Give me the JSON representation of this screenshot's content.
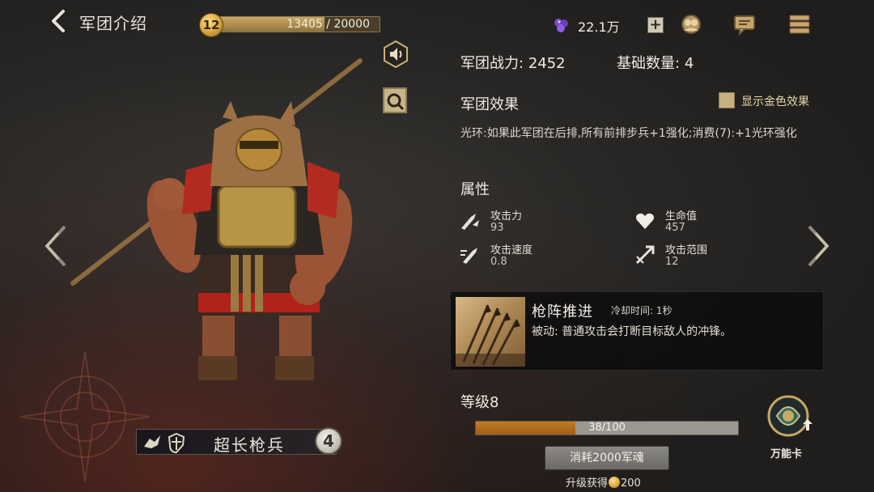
{
  "header": {
    "title": "军团介绍",
    "level": "12",
    "xp_current": "13405",
    "xp_separator": "/",
    "xp_max": "20000",
    "xp_fraction": 0.67,
    "gems": "22.1万",
    "gem_plus": "+"
  },
  "icons": {
    "back": "back-arrow-icon",
    "gem": "purple-gem-icon",
    "alliance": "alliance-icon",
    "chat": "chat-icon",
    "menu": "menu-icon",
    "sound": "speaker-icon",
    "inspect": "magnifier-icon",
    "prev": "left-arrow-icon",
    "next": "right-arrow-icon"
  },
  "unit": {
    "name": "超长枪兵",
    "tier": "4"
  },
  "info": {
    "power_label": "军团战力:",
    "power_value": "2452",
    "base_label": "基础数量:",
    "base_value": "4",
    "effect_title": "军团效果",
    "gold_toggle_label": "显示金色效果",
    "effect_desc": "光环:如果此军团在后排,所有前排步兵+1强化;消费(7):+1光环强化",
    "attr_title": "属性",
    "stats": [
      {
        "name": "攻击力",
        "value": "93",
        "icon": "attack-icon"
      },
      {
        "name": "生命值",
        "value": "457",
        "icon": "heart-icon"
      },
      {
        "name": "攻击速度",
        "value": "0.8",
        "icon": "attack-speed-icon"
      },
      {
        "name": "攻击范围",
        "value": "12",
        "icon": "attack-range-icon"
      }
    ]
  },
  "skill": {
    "name": "枪阵推进",
    "cooldown": "冷却时间: 1秒",
    "desc": "被动: 普通攻击会打断目标敌人的冲锋。"
  },
  "level": {
    "title": "等级8",
    "progress_text": "38/100",
    "progress_fraction": 0.38,
    "consume_label": "消耗2000军魂",
    "reward_prefix": "升级获得",
    "reward_value": "200"
  },
  "wild_card": {
    "label": "万能卡"
  },
  "colors": {
    "gold": "#c9a765",
    "level_fill": "#c37b22",
    "background": "#2a2826"
  }
}
